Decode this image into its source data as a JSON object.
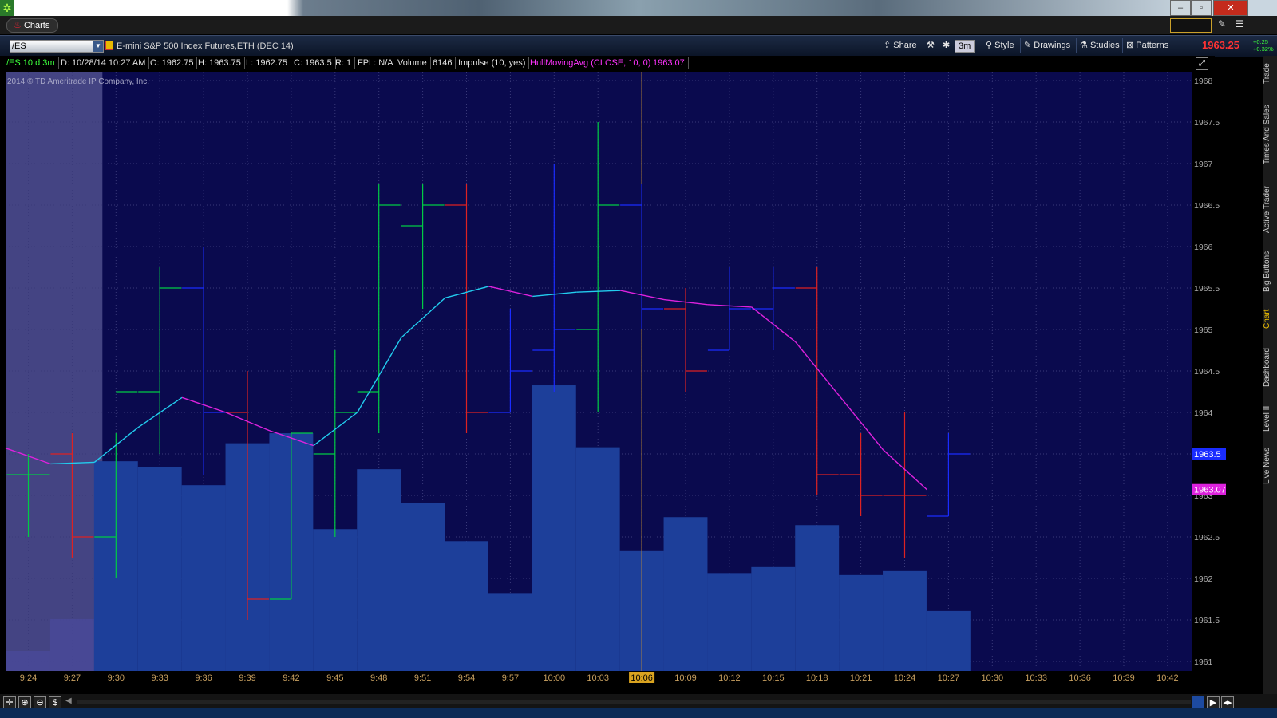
{
  "window": {
    "minimize": "–",
    "restore": "▫",
    "close": "✕"
  },
  "tab": {
    "label": "Charts"
  },
  "toolbar": {
    "symbol": "/ES",
    "description": "E-mini S&P 500 Index Futures,ETH (DEC 14)",
    "share": "Share",
    "period": "3m",
    "style": "Style",
    "drawings": "Drawings",
    "studies": "Studies",
    "patterns": "Patterns",
    "last_price": "1963.25",
    "change": "+0.25",
    "change_pct": "+0.32%"
  },
  "info": {
    "sym_period": "/ES 10 d 3m",
    "date": "D: 10/28/14 10:27 AM",
    "open": "O: 1962.75",
    "high": "H: 1963.75",
    "low": "L: 1962.75",
    "close": "C: 1963.5",
    "range": "R: 1",
    "fpl": "FPL: N/A",
    "volume_label": "Volume",
    "volume": "6146",
    "impulse": "Impulse (10, yes)",
    "hull": "HullMovingAvg (CLOSE, 10, 0)",
    "hull_value": "1963.07"
  },
  "copyright": "2014 © TD Ameritrade IP Company, Inc.",
  "sidebar": [
    "Trade",
    "Times And Sales",
    "Active Trader",
    "Big Buttons",
    "Chart",
    "Dashboard",
    "Level II",
    "Live News"
  ],
  "colors": {
    "up": "#00cc44",
    "down": "#dd2222",
    "neutral": "#1a2cff",
    "hull_up": "#22ccee",
    "hull_down": "#dd22dd",
    "volume": "#1d3f9a",
    "crosshair_time": "#d9a320"
  },
  "chart_data": {
    "type": "ohlc",
    "price_axis": {
      "min": 1961,
      "max": 1968,
      "ticks": [
        "1968",
        "1967.5",
        "1967",
        "1966.5",
        "1966",
        "1965.5",
        "1965",
        "1964.5",
        "1964",
        "1963.5",
        "1963",
        "1962.5",
        "1962",
        "1961.5",
        "1961"
      ]
    },
    "time_ticks": [
      "9:24",
      "9:27",
      "9:30",
      "9:33",
      "9:36",
      "9:39",
      "9:42",
      "9:45",
      "9:48",
      "9:51",
      "9:54",
      "9:57",
      "10:00",
      "10:03",
      "10:06",
      "10:09",
      "10:12",
      "10:15",
      "10:18",
      "10:21",
      "10:24",
      "10:27",
      "10:30",
      "10:33",
      "10:36",
      "10:39",
      "10:42"
    ],
    "crosshair_time": "10:06",
    "bars": [
      {
        "t": "9:24",
        "o": 1963.25,
        "h": 1963.5,
        "l": 1962.5,
        "c": 1963.25,
        "col": "up"
      },
      {
        "t": "9:27",
        "o": 1963.5,
        "h": 1963.75,
        "l": 1962.25,
        "c": 1962.5,
        "col": "down"
      },
      {
        "t": "9:30",
        "o": 1962.5,
        "h": 1963.75,
        "l": 1962.0,
        "c": 1964.25,
        "col": "up"
      },
      {
        "t": "9:33",
        "o": 1964.25,
        "h": 1965.75,
        "l": 1963.5,
        "c": 1965.5,
        "col": "up"
      },
      {
        "t": "9:36",
        "o": 1965.5,
        "h": 1966.0,
        "l": 1963.25,
        "c": 1964.0,
        "col": "neutral"
      },
      {
        "t": "9:39",
        "o": 1964.0,
        "h": 1964.5,
        "l": 1961.5,
        "c": 1961.75,
        "col": "down"
      },
      {
        "t": "9:42",
        "o": 1961.75,
        "h": 1963.75,
        "l": 1961.75,
        "c": 1963.75,
        "col": "up"
      },
      {
        "t": "9:45",
        "o": 1963.5,
        "h": 1964.75,
        "l": 1962.5,
        "c": 1964.0,
        "col": "up"
      },
      {
        "t": "9:48",
        "o": 1964.25,
        "h": 1966.75,
        "l": 1963.75,
        "c": 1966.5,
        "col": "up"
      },
      {
        "t": "9:51",
        "o": 1966.25,
        "h": 1966.75,
        "l": 1965.25,
        "c": 1966.5,
        "col": "up"
      },
      {
        "t": "9:54",
        "o": 1966.5,
        "h": 1966.75,
        "l": 1963.75,
        "c": 1964.0,
        "col": "down"
      },
      {
        "t": "9:57",
        "o": 1964.0,
        "h": 1965.25,
        "l": 1964.0,
        "c": 1964.5,
        "col": "neutral"
      },
      {
        "t": "10:00",
        "o": 1964.75,
        "h": 1967.0,
        "l": 1964.25,
        "c": 1965.0,
        "col": "neutral"
      },
      {
        "t": "10:03",
        "o": 1965.0,
        "h": 1967.5,
        "l": 1964.0,
        "c": 1966.5,
        "col": "up"
      },
      {
        "t": "10:06",
        "o": 1966.5,
        "h": 1966.75,
        "l": 1965.0,
        "c": 1965.25,
        "col": "neutral"
      },
      {
        "t": "10:09",
        "o": 1965.25,
        "h": 1965.5,
        "l": 1964.25,
        "c": 1964.5,
        "col": "down"
      },
      {
        "t": "10:12",
        "o": 1964.75,
        "h": 1965.75,
        "l": 1964.75,
        "c": 1965.25,
        "col": "neutral"
      },
      {
        "t": "10:15",
        "o": 1965.25,
        "h": 1965.75,
        "l": 1964.75,
        "c": 1965.5,
        "col": "neutral"
      },
      {
        "t": "10:18",
        "o": 1965.5,
        "h": 1965.75,
        "l": 1963.0,
        "c": 1963.25,
        "col": "down"
      },
      {
        "t": "10:21",
        "o": 1963.25,
        "h": 1963.75,
        "l": 1962.75,
        "c": 1963.0,
        "col": "down"
      },
      {
        "t": "10:24",
        "o": 1963.0,
        "h": 1964.0,
        "l": 1962.25,
        "c": 1963.0,
        "col": "down"
      },
      {
        "t": "10:27",
        "o": 1962.75,
        "h": 1963.75,
        "l": 1962.75,
        "c": 1963.5,
        "col": "neutral"
      }
    ],
    "volume": [
      10,
      26,
      105,
      102,
      93,
      114,
      119,
      71,
      101,
      84,
      65,
      39,
      143,
      112,
      60,
      77,
      49,
      52,
      73,
      48,
      50,
      30
    ],
    "volume_max": 300,
    "hull": [
      {
        "t": "9:24",
        "v": 1963.57
      },
      {
        "t": "9:27",
        "v": 1963.38
      },
      {
        "t": "9:30",
        "v": 1963.4
      },
      {
        "t": "9:33",
        "v": 1963.82
      },
      {
        "t": "9:36",
        "v": 1964.18
      },
      {
        "t": "9:39",
        "v": 1964.0
      },
      {
        "t": "9:42",
        "v": 1963.78
      },
      {
        "t": "9:45",
        "v": 1963.6
      },
      {
        "t": "9:48",
        "v": 1964.0
      },
      {
        "t": "9:51",
        "v": 1964.9
      },
      {
        "t": "9:54",
        "v": 1965.38
      },
      {
        "t": "9:57",
        "v": 1965.52
      },
      {
        "t": "10:00",
        "v": 1965.4
      },
      {
        "t": "10:03",
        "v": 1965.45
      },
      {
        "t": "10:06",
        "v": 1965.47
      },
      {
        "t": "10:09",
        "v": 1965.36
      },
      {
        "t": "10:12",
        "v": 1965.3
      },
      {
        "t": "10:15",
        "v": 1965.27
      },
      {
        "t": "10:18",
        "v": 1964.85
      },
      {
        "t": "10:21",
        "v": 1964.2
      },
      {
        "t": "10:24",
        "v": 1963.55
      },
      {
        "t": "10:27",
        "v": 1963.07
      }
    ],
    "price_labels": [
      {
        "value": 1963.5,
        "text": "1963.5",
        "color": "#1a2cff"
      },
      {
        "value": 1963.07,
        "text": "1963.07",
        "color": "#dd22dd"
      }
    ]
  }
}
